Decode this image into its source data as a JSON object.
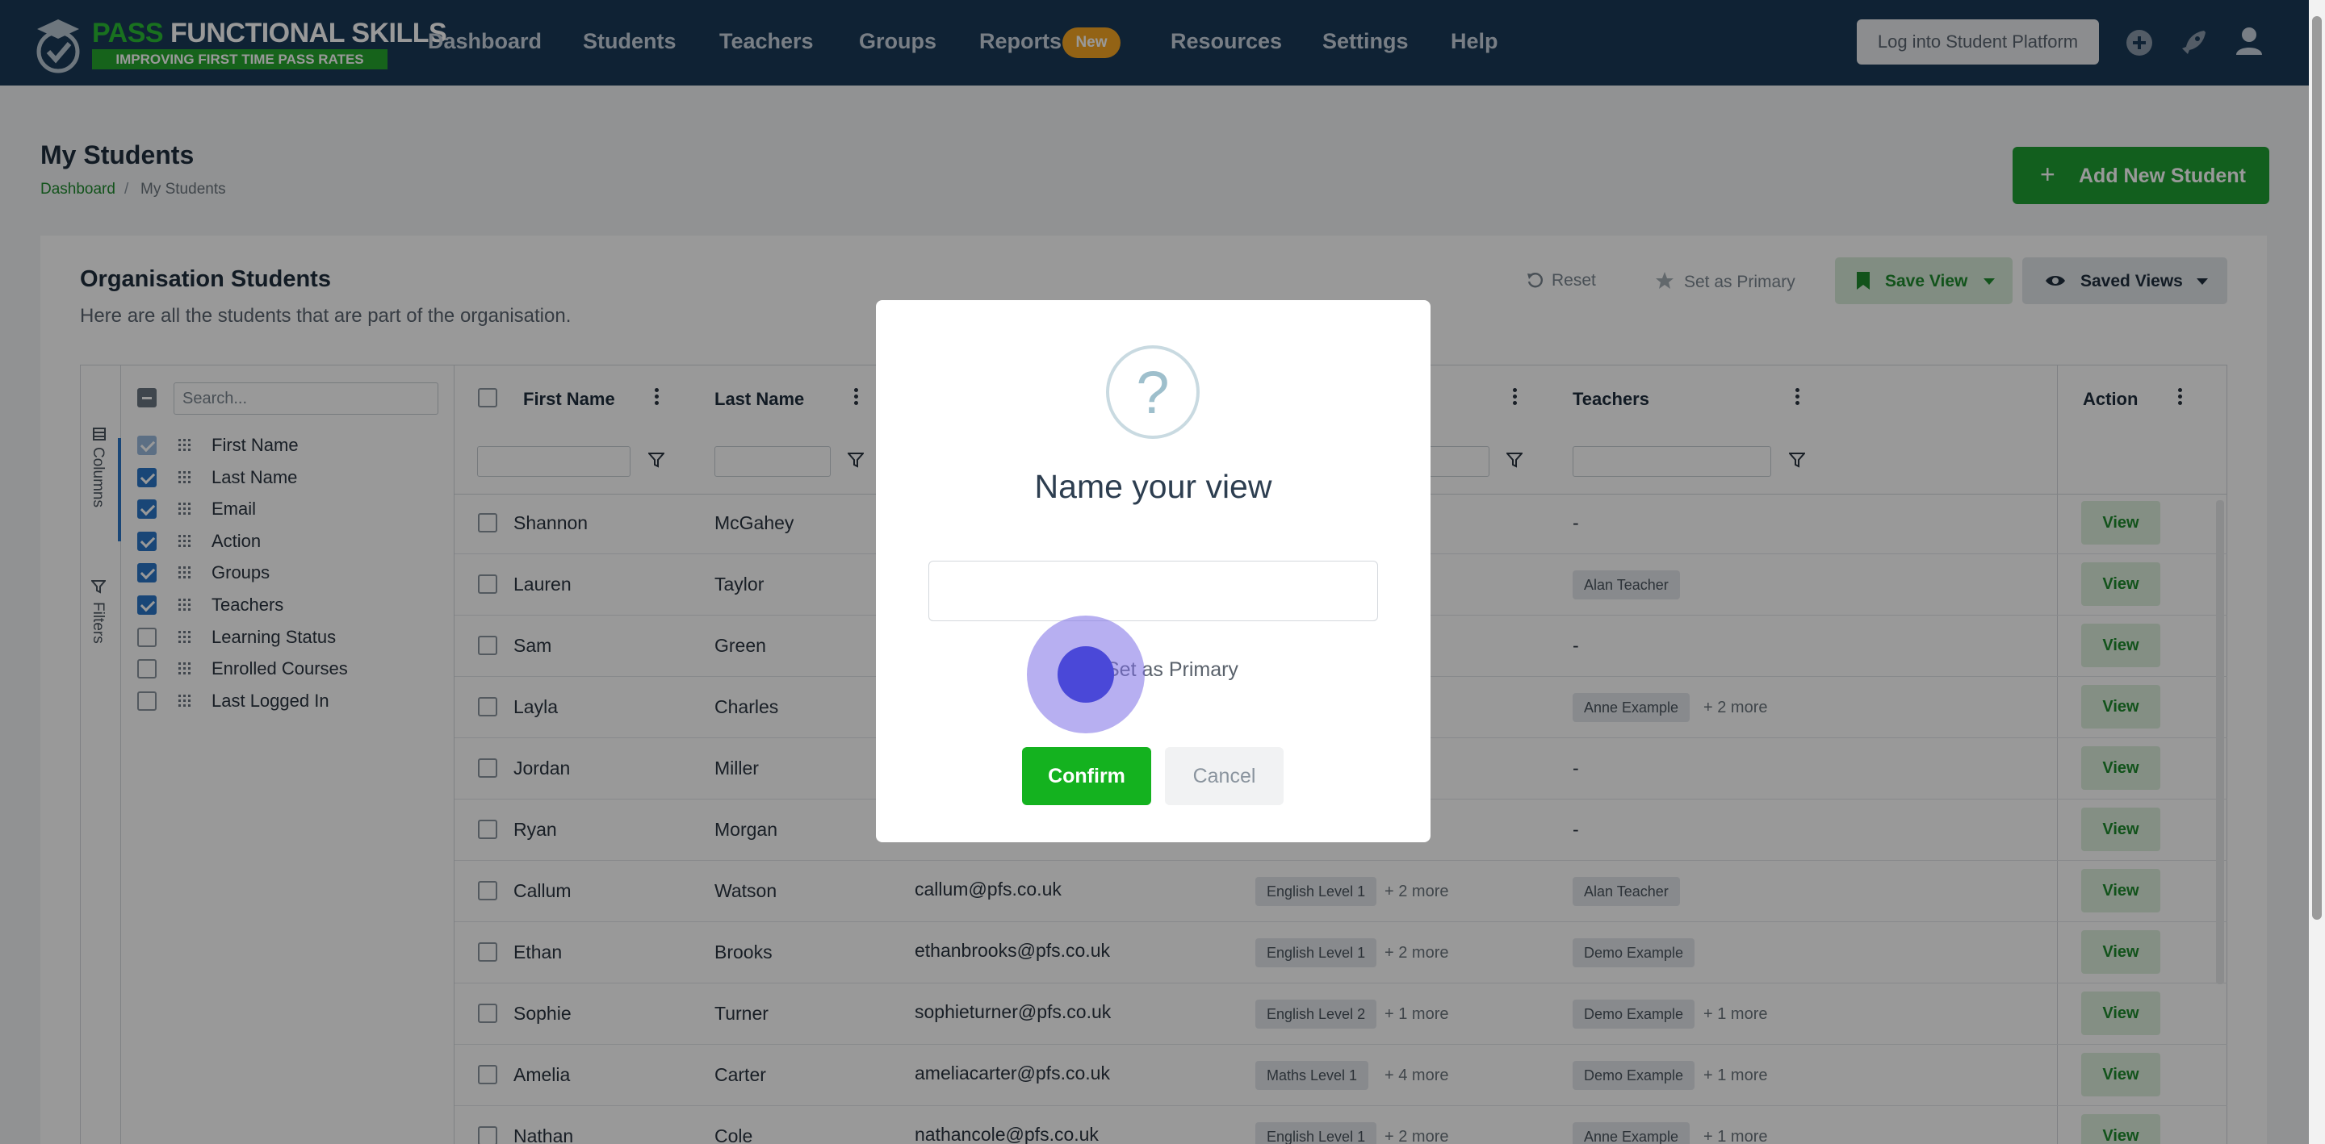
{
  "brand": {
    "title_part1": "PASS",
    "title_part2": "FUNCTIONAL SKILLS",
    "tagline": "IMPROVING FIRST TIME PASS RATES"
  },
  "nav": {
    "items": [
      "Dashboard",
      "Students",
      "Teachers",
      "Groups",
      "Reports",
      "Resources",
      "Settings",
      "Help"
    ],
    "reports_badge": "New",
    "student_platform_button": "Log into Student Platform",
    "icons": [
      "plus-circle-icon",
      "rocket-icon",
      "user-icon"
    ]
  },
  "page": {
    "title": "My Students",
    "breadcrumb": {
      "link": "Dashboard",
      "separator": "/",
      "current": "My Students"
    },
    "add_button": "Add New Student"
  },
  "card": {
    "title": "Organisation Students",
    "subtitle": "Here are all the students that are part of the organisation.",
    "toolbar": {
      "reset": "Reset",
      "set_primary": "Set as Primary",
      "save_view": "Save View",
      "saved_views": "Saved Views"
    }
  },
  "grid": {
    "side_tabs": {
      "columns": "Columns",
      "filters": "Filters"
    },
    "search_placeholder": "Search...",
    "column_toggles": [
      {
        "label": "First Name",
        "checked": true
      },
      {
        "label": "Last Name",
        "checked": true
      },
      {
        "label": "Email",
        "checked": true
      },
      {
        "label": "Action",
        "checked": true
      },
      {
        "label": "Groups",
        "checked": true
      },
      {
        "label": "Teachers",
        "checked": true
      },
      {
        "label": "Learning Status",
        "checked": false
      },
      {
        "label": "Enrolled Courses",
        "checked": false
      },
      {
        "label": "Last Logged In",
        "checked": false
      }
    ],
    "headers": {
      "first_name": "First Name",
      "last_name": "Last Name",
      "teachers": "Teachers",
      "action": "Action"
    },
    "view_label": "View",
    "rows": [
      {
        "first": "Shannon",
        "last": "McGahey",
        "email": "",
        "group": "",
        "group_more": "",
        "teacher": "-",
        "teacher_more": ""
      },
      {
        "first": "Lauren",
        "last": "Taylor",
        "email": "",
        "group": "",
        "group_more": "",
        "teacher": "Alan Teacher",
        "teacher_more": ""
      },
      {
        "first": "Sam",
        "last": "Green",
        "email": "",
        "group": "",
        "group_more": "",
        "teacher": "-",
        "teacher_more": ""
      },
      {
        "first": "Layla",
        "last": "Charles",
        "email": "",
        "group": "",
        "group_more": "",
        "teacher": "Anne Example",
        "teacher_more": "+ 2 more"
      },
      {
        "first": "Jordan",
        "last": "Miller",
        "email": "",
        "group": "",
        "group_more": "",
        "teacher": "-",
        "teacher_more": ""
      },
      {
        "first": "Ryan",
        "last": "Morgan",
        "email": "",
        "group": "",
        "group_more": "",
        "teacher": "-",
        "teacher_more": ""
      },
      {
        "first": "Callum",
        "last": "Watson",
        "email": "callum@pfs.co.uk",
        "group": "English Level 1",
        "group_more": "+ 2 more",
        "teacher": "Alan Teacher",
        "teacher_more": ""
      },
      {
        "first": "Ethan",
        "last": "Brooks",
        "email": "ethanbrooks@pfs.co.uk",
        "group": "English Level 1",
        "group_more": "+ 2 more",
        "teacher": "Demo Example",
        "teacher_more": ""
      },
      {
        "first": "Sophie",
        "last": "Turner",
        "email": "sophieturner@pfs.co.uk",
        "group": "English Level 2",
        "group_more": "+ 1 more",
        "teacher": "Demo Example",
        "teacher_more": "+ 1 more"
      },
      {
        "first": "Amelia",
        "last": "Carter",
        "email": "ameliacarter@pfs.co.uk",
        "group": "Maths Level 1",
        "group_more": "+ 4 more",
        "teacher": "Demo Example",
        "teacher_more": "+ 1 more"
      },
      {
        "first": "Nathan",
        "last": "Cole",
        "email": "nathancole@pfs.co.uk",
        "group": "English Level 1",
        "group_more": "+ 2 more",
        "teacher": "Anne Example",
        "teacher_more": "+ 1 more"
      }
    ]
  },
  "modal": {
    "icon": "?",
    "title": "Name your view",
    "input_value": "",
    "checkbox_label": "Set as Primary",
    "confirm": "Confirm",
    "cancel": "Cancel"
  },
  "colors": {
    "navbar": "#1a3a57",
    "brand_green": "#1e9e33",
    "confirm_green": "#14b21f",
    "checkbox_blue": "#2a76c6",
    "badge_orange": "#f5a623"
  }
}
